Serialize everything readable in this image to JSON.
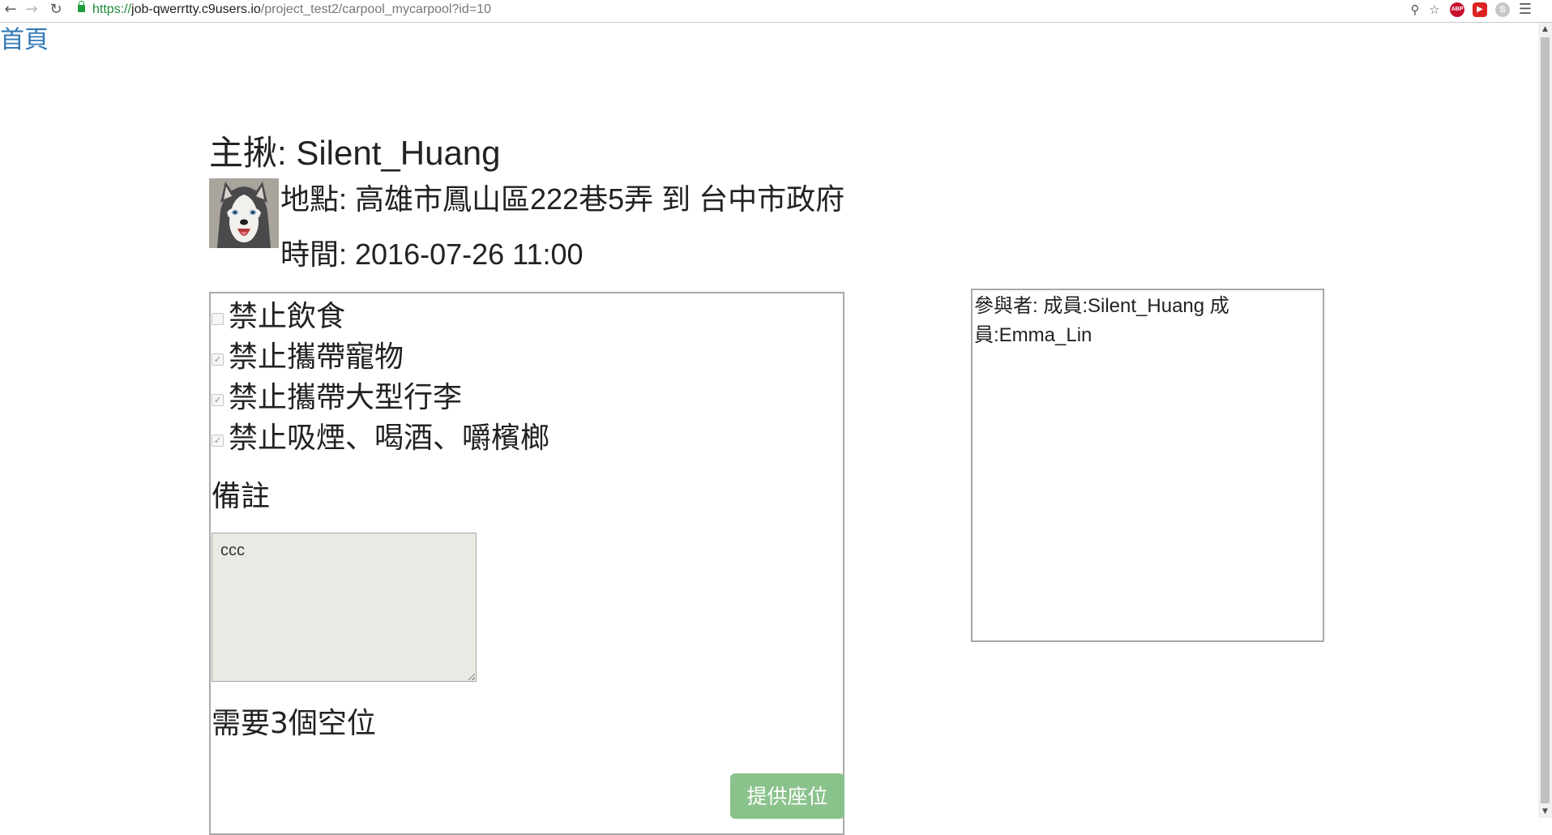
{
  "browser": {
    "url_scheme": "https://",
    "url_host": "job-qwerrtty.c9users.io",
    "url_path": "/project_test2/carpool_mycarpool?id=10",
    "icons": [
      "back-arrow-icon",
      "forward-arrow-icon",
      "reload-icon",
      "lock-icon",
      "zoom-icon",
      "star-icon",
      "adblock-icon",
      "record-icon",
      "skype-icon",
      "menu-icon"
    ],
    "abp_text": "ABP",
    "skype_text": "S"
  },
  "nav": {
    "home": "首頁"
  },
  "ride": {
    "host": "主揪: Silent_Huang",
    "location": "地點: 高雄市鳳山區222巷5弄 到 台中市政府",
    "time": "時間: 2016-07-26 11:00"
  },
  "rules": [
    {
      "label": "禁止飲食",
      "checked": false
    },
    {
      "label": "禁止攜帶寵物",
      "checked": true
    },
    {
      "label": "禁止攜帶大型行李",
      "checked": true
    },
    {
      "label": "禁止吸煙、喝酒、嚼檳榔",
      "checked": true
    }
  ],
  "notes": {
    "label": "備註",
    "value": "ccc"
  },
  "seats": {
    "label": "需要3個空位"
  },
  "actions": {
    "offer_seat": "提供座位"
  },
  "participants": {
    "text": "參與者: 成員:Silent_Huang 成員:Emma_Lin"
  },
  "colors": {
    "link": "#337ab7",
    "button_bg": "#8ac28b",
    "notes_bg": "#ebe9e3",
    "url_scheme": "#1e8a3a"
  }
}
